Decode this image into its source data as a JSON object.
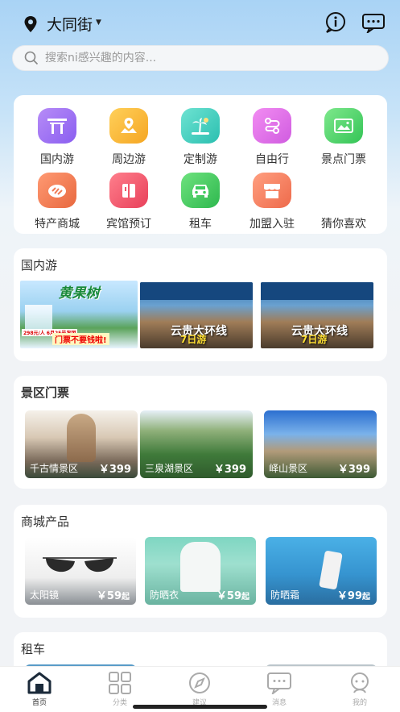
{
  "header": {
    "location": "大同街",
    "info_icon": "info-icon",
    "message_icon": "chat-icon"
  },
  "search": {
    "placeholder": "搜索ni感兴趣的内容..."
  },
  "categories": [
    {
      "label": "国内游",
      "icon": "gate-icon",
      "color": "#9a6cf0"
    },
    {
      "label": "周边游",
      "icon": "map-pin-icon",
      "color": "#f5b233"
    },
    {
      "label": "定制游",
      "icon": "palm-tree-icon",
      "color": "#3fd0c0"
    },
    {
      "label": "自由行",
      "icon": "route-icon",
      "color": "#e065e6"
    },
    {
      "label": "景点门票",
      "icon": "ticket-icon",
      "color": "#4dd06a"
    },
    {
      "label": "特产商城",
      "icon": "shop-icon",
      "color": "#f07b55"
    },
    {
      "label": "宾馆预订",
      "icon": "hotel-icon",
      "color": "#f0566a"
    },
    {
      "label": "租车",
      "icon": "car-icon",
      "color": "#3ecb5e"
    },
    {
      "label": "加盟入驻",
      "icon": "store-icon",
      "color": "#f47d5d"
    },
    {
      "label": "猜你喜欢",
      "icon": "",
      "color": ""
    }
  ],
  "domestic": {
    "title": "国内游",
    "banners": [
      {
        "title": "黄果树",
        "caption": "门票不要钱啦!",
        "sub": "298元/人 6月25号发团"
      },
      {
        "title": "云贵大环线",
        "caption": "7日游"
      },
      {
        "title": "云贵大环线",
        "caption": "7日游"
      }
    ]
  },
  "tickets": {
    "title": "景区门票",
    "items": [
      {
        "name": "千古情景区",
        "price": "￥399"
      },
      {
        "name": "三泉湖景区",
        "price": "￥399"
      },
      {
        "name": "峄山景区",
        "price": "￥399"
      }
    ]
  },
  "mall": {
    "title": "商城产品",
    "items": [
      {
        "name": "太阳镜",
        "price": "￥59",
        "unit": "起"
      },
      {
        "name": "防晒衣",
        "price": "￥59",
        "unit": "起"
      },
      {
        "name": "防晒霜",
        "price": "￥99",
        "unit": "起"
      }
    ]
  },
  "rental": {
    "title": "租车"
  },
  "nav": [
    {
      "label": "首页",
      "icon": "home-icon",
      "active": true
    },
    {
      "label": "分类",
      "icon": "grid-icon",
      "active": false
    },
    {
      "label": "建议",
      "icon": "compass-icon",
      "active": false
    },
    {
      "label": "消息",
      "icon": "message-icon",
      "active": false
    },
    {
      "label": "我的",
      "icon": "profile-icon",
      "active": false
    }
  ]
}
